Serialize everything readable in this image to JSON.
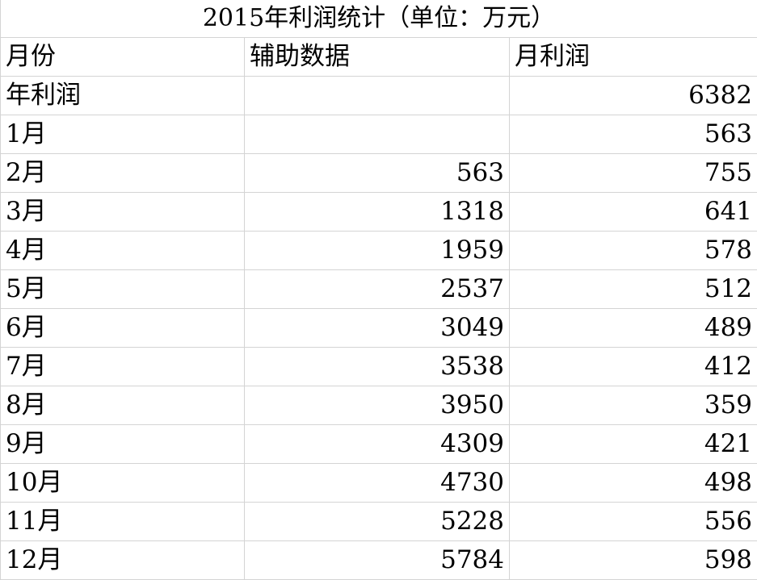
{
  "sheet": {
    "title": "2015年利润统计（单位：万元）",
    "headers": [
      "月份",
      "辅助数据",
      "月利润"
    ],
    "rows": [
      {
        "label": "年利润",
        "aux": "",
        "profit": "6382"
      },
      {
        "label": "1月",
        "aux": "",
        "profit": "563"
      },
      {
        "label": "2月",
        "aux": "563",
        "profit": "755"
      },
      {
        "label": "3月",
        "aux": "1318",
        "profit": "641"
      },
      {
        "label": "4月",
        "aux": "1959",
        "profit": "578"
      },
      {
        "label": "5月",
        "aux": "2537",
        "profit": "512"
      },
      {
        "label": "6月",
        "aux": "3049",
        "profit": "489"
      },
      {
        "label": "7月",
        "aux": "3538",
        "profit": "412"
      },
      {
        "label": "8月",
        "aux": "3950",
        "profit": "359"
      },
      {
        "label": "9月",
        "aux": "4309",
        "profit": "421"
      },
      {
        "label": "10月",
        "aux": "4730",
        "profit": "498"
      },
      {
        "label": "11月",
        "aux": "5228",
        "profit": "556"
      },
      {
        "label": "12月",
        "aux": "5784",
        "profit": "598"
      }
    ]
  },
  "colors": {
    "gridline": "#d4d4d4",
    "text": "#000000",
    "background": "#ffffff"
  }
}
